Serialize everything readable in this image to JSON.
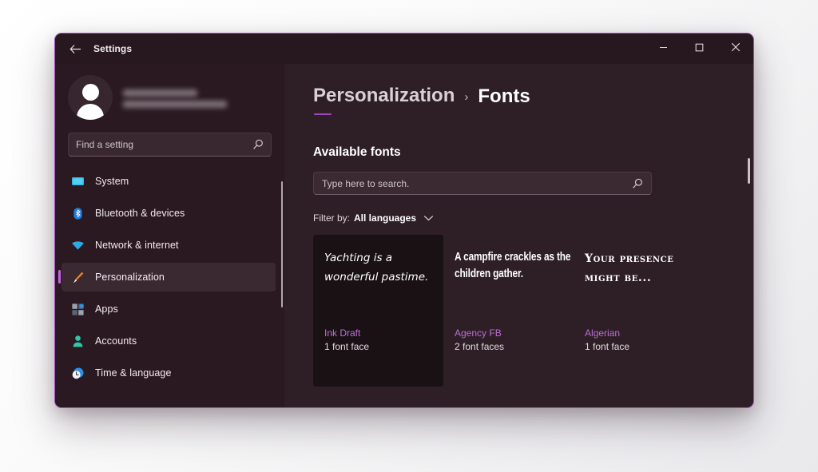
{
  "window": {
    "app_title": "Settings",
    "back_icon": "back-arrow-icon",
    "controls": {
      "minimize": "minimize-icon",
      "maximize": "maximize-icon",
      "close": "close-icon"
    },
    "accent_border_color": "#a44fc4",
    "background_color": "#2e1e26"
  },
  "sidebar": {
    "background_color": "#2a1920",
    "profile": {
      "avatar_icon": "user-avatar-icon",
      "name_redacted": "",
      "email_redacted": ""
    },
    "search": {
      "placeholder": "Find a setting",
      "value": "",
      "icon": "search-icon"
    },
    "items": [
      {
        "label": "System",
        "icon": "monitor-icon",
        "color": "#2fb8e6",
        "active": false
      },
      {
        "label": "Bluetooth & devices",
        "icon": "bluetooth-icon",
        "color": "#1e7fe0",
        "active": false
      },
      {
        "label": "Network & internet",
        "icon": "wifi-icon",
        "color": "#2fa8e8",
        "active": false
      },
      {
        "label": "Personalization",
        "icon": "paintbrush-icon",
        "color": "#e8842a",
        "active": true
      },
      {
        "label": "Apps",
        "icon": "apps-grid-icon",
        "color": "#8f98a8",
        "active": false
      },
      {
        "label": "Accounts",
        "icon": "person-icon",
        "color": "#2fc7a8",
        "active": false
      },
      {
        "label": "Time & language",
        "icon": "clock-globe-icon",
        "color": "#2f8fe0",
        "active": false
      }
    ],
    "selection_indicator_color": "#c464e0"
  },
  "main": {
    "breadcrumb": {
      "parent": "Personalization",
      "separator": "›",
      "current": "Fonts",
      "underline_color": "#9c45bd"
    },
    "section_title": "Available fonts",
    "font_search": {
      "placeholder": "Type here to search.",
      "value": "",
      "icon": "search-icon"
    },
    "filter": {
      "label": "Filter by:",
      "value": "All languages",
      "chevron_icon": "chevron-down-icon"
    },
    "font_cards": [
      {
        "preview": "Yachting is a wonderful pastime.",
        "name": "Ink Draft",
        "faces": "1 font face",
        "style": "script",
        "hovered": true
      },
      {
        "preview": "A campfire crackles as the children gather.",
        "name": "Agency FB",
        "faces": "2 font faces",
        "style": "narrow",
        "hovered": false
      },
      {
        "preview": "Your presence might be...",
        "name": "Algerian",
        "faces": "1 font face",
        "style": "decorative",
        "hovered": false
      }
    ],
    "name_accent_color": "#bb6fd6"
  }
}
